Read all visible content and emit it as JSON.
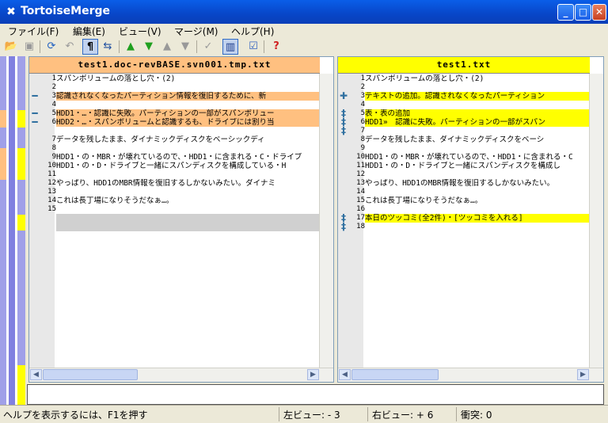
{
  "window": {
    "title": "TortoiseMerge",
    "minimize": "_",
    "maximize": "□",
    "close": "✕"
  },
  "menu": [
    "ファイル(F)",
    "編集(E)",
    "ビュー(V)",
    "マージ(M)",
    "ヘルプ(H)"
  ],
  "left_pane": {
    "header": "test1.doc-revBASE.svn001.tmp.txt",
    "header_color": "#ffc080",
    "lines": [
      {
        "num": "1",
        "text": "スパンボリュームの落とし穴・(2)",
        "state": "normal"
      },
      {
        "num": "2",
        "text": "",
        "state": "normal"
      },
      {
        "num": "3",
        "text": "認識されなくなったパーティション情報を復旧するために、新",
        "state": "removed"
      },
      {
        "num": "4",
        "text": "",
        "state": "normal"
      },
      {
        "num": "5",
        "text": "HDD1・…・認識に失敗。パーティションの一部がスパンボリュー",
        "state": "removed"
      },
      {
        "num": "6",
        "text": "HDD2・…・スパンボリュームと認識するも、ドライブには割り当",
        "state": "removed"
      },
      {
        "num": "",
        "text": "",
        "state": "normal"
      },
      {
        "num": "7",
        "text": "データを残したまま、ダイナミックディスクをベーシックディ",
        "state": "normal"
      },
      {
        "num": "8",
        "text": "",
        "state": "normal"
      },
      {
        "num": "9",
        "text": "HDD1・の・MBR・が壊れているので、・HDD1・に含まれる・C・ドライブ",
        "state": "normal"
      },
      {
        "num": "10",
        "text": "HDD1・の・D・ドライブと一緒にスパンディスクを構成している・H",
        "state": "normal"
      },
      {
        "num": "11",
        "text": "",
        "state": "normal"
      },
      {
        "num": "12",
        "text": "やっぱり、HDD1のMBR情報を復旧するしかないみたい。ダイナミ",
        "state": "normal"
      },
      {
        "num": "13",
        "text": "",
        "state": "normal"
      },
      {
        "num": "14",
        "text": "これは長丁場になりそうだなぁ…。",
        "state": "normal"
      },
      {
        "num": "15",
        "text": "",
        "state": "normal"
      },
      {
        "num": "",
        "text": "",
        "state": "ghost"
      },
      {
        "num": "",
        "text": "",
        "state": "ghost"
      }
    ]
  },
  "right_pane": {
    "header": "test1.txt",
    "header_color": "#ffff00",
    "lines": [
      {
        "num": "1",
        "text": "スパンボリュームの落とし穴・(2)",
        "state": "normal"
      },
      {
        "num": "2",
        "text": "",
        "state": "normal"
      },
      {
        "num": "3",
        "text": "テキストの追加。認識されなくなったパーティション",
        "state": "added"
      },
      {
        "num": "4",
        "text": "",
        "state": "normal"
      },
      {
        "num": "5",
        "text": "表・表の追加",
        "state": "added"
      },
      {
        "num": "6",
        "text": "HDD1»　認識に失敗。パーティションの一部がスパン",
        "state": "added"
      },
      {
        "num": "7",
        "text": "",
        "state": "normal"
      },
      {
        "num": "8",
        "text": "データを残したまま、ダイナミックディスクをベーシ",
        "state": "normal"
      },
      {
        "num": "9",
        "text": "",
        "state": "normal"
      },
      {
        "num": "10",
        "text": "HDD1・の・MBR・が壊れているので、・HDD1・に含まれる・C",
        "state": "normal"
      },
      {
        "num": "11",
        "text": "HDD1・の・D・ドライブと一緒にスパンディスクを構成し",
        "state": "normal"
      },
      {
        "num": "12",
        "text": "",
        "state": "normal"
      },
      {
        "num": "13",
        "text": "やっぱり、HDD1のMBR情報を復旧するしかないみたい。",
        "state": "normal"
      },
      {
        "num": "14",
        "text": "",
        "state": "normal"
      },
      {
        "num": "15",
        "text": "これは長丁場になりそうだなぁ…。",
        "state": "normal"
      },
      {
        "num": "16",
        "text": "",
        "state": "normal"
      },
      {
        "num": "17",
        "text": "本日のツッコミ(全2件)・[ツッコミを入れる]",
        "state": "added"
      },
      {
        "num": "18",
        "text": "",
        "state": "normal"
      }
    ]
  },
  "status": {
    "help": "ヘルプを表示するには、F1を押す",
    "left_view": "左ビュー: - 3",
    "right_view": "右ビュー: + 6",
    "conflict": "衝突: 0"
  }
}
